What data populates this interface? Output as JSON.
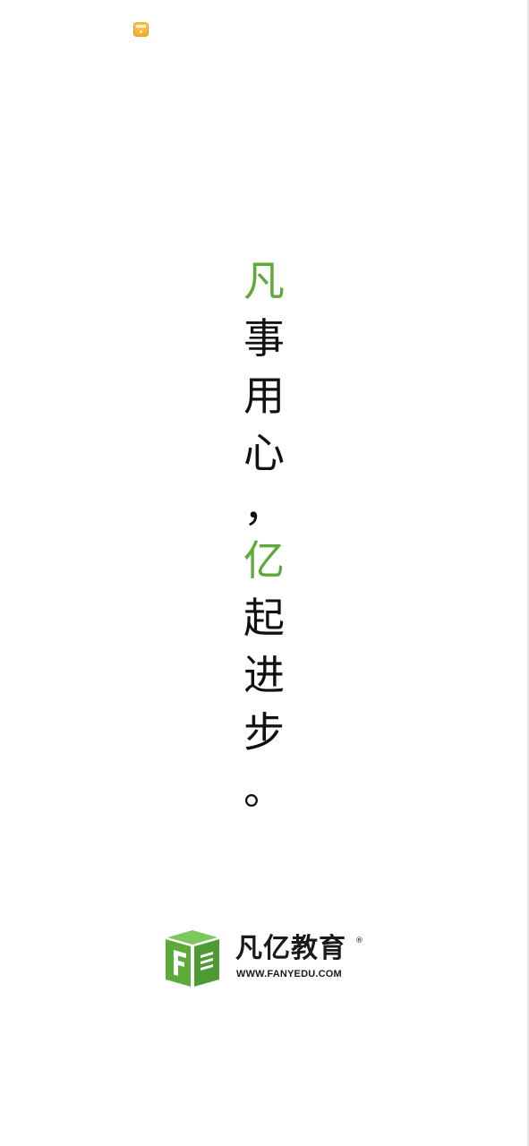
{
  "status_bar": {
    "icon": "app-notification-icon"
  },
  "slogan": {
    "chars": [
      {
        "text": "凡",
        "accent": true
      },
      {
        "text": "事",
        "accent": false
      },
      {
        "text": "用",
        "accent": false
      },
      {
        "text": "心",
        "accent": false
      },
      {
        "text": "，",
        "accent": false
      },
      {
        "text": "亿",
        "accent": true
      },
      {
        "text": "起",
        "accent": false
      },
      {
        "text": "进",
        "accent": false
      },
      {
        "text": "步",
        "accent": false
      },
      {
        "text": "。",
        "accent": false
      }
    ]
  },
  "brand": {
    "name": "凡亿教育",
    "registered_mark": "®",
    "url": "WWW.FANYEDU.COM",
    "icon": "fanyi-logo-icon"
  },
  "colors": {
    "accent_green": "#5daa3a",
    "text_dark": "#111111",
    "background": "#ffffff"
  }
}
